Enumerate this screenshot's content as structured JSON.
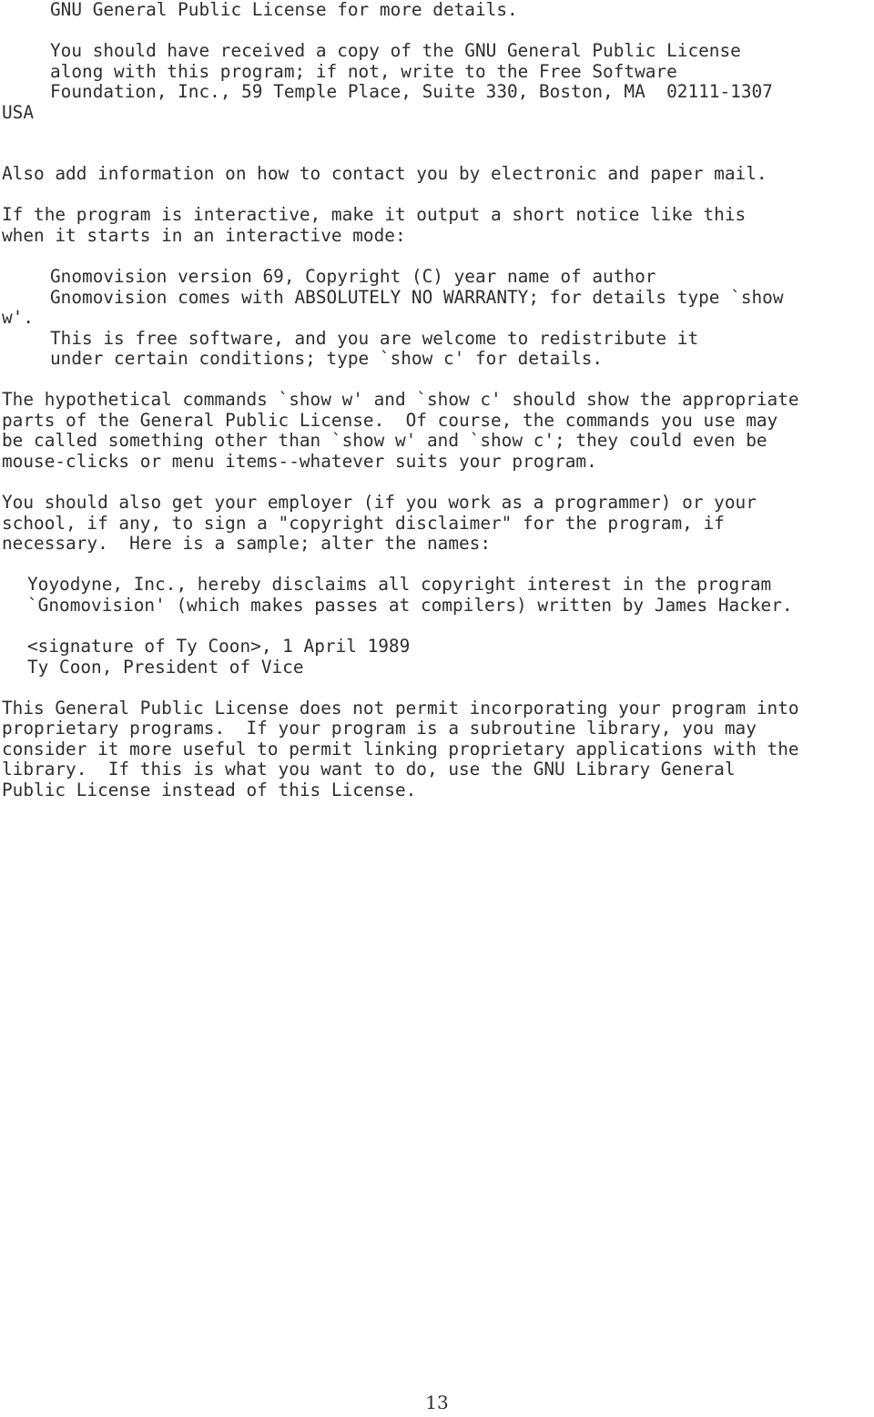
{
  "document": {
    "page_number": "13",
    "text_color": "#2e2e2e",
    "background_color": "#ffffff",
    "lines": [
      {
        "indent": "q",
        "text": "GNU General Public License for more details."
      },
      {
        "indent": "blank",
        "text": ""
      },
      {
        "indent": "q",
        "text": "You should have received a copy of the GNU General Public License"
      },
      {
        "indent": "q",
        "text": "along with this program; if not, write to the Free Software"
      },
      {
        "indent": "q",
        "text": "Foundation, Inc., 59 Temple Place, Suite 330, Boston, MA  02111-1307"
      },
      {
        "indent": "0",
        "text": "USA"
      },
      {
        "indent": "blank",
        "text": ""
      },
      {
        "indent": "blank",
        "text": ""
      },
      {
        "indent": "0",
        "text": "Also add information on how to contact you by electronic and paper mail."
      },
      {
        "indent": "blank",
        "text": ""
      },
      {
        "indent": "0",
        "text": "If the program is interactive, make it output a short notice like this"
      },
      {
        "indent": "0",
        "text": "when it starts in an interactive mode:"
      },
      {
        "indent": "blank",
        "text": ""
      },
      {
        "indent": "q",
        "text": "Gnomovision version 69, Copyright (C) year name of author"
      },
      {
        "indent": "q",
        "text": "Gnomovision comes with ABSOLUTELY NO WARRANTY; for details type `show"
      },
      {
        "indent": "0",
        "text": "w'."
      },
      {
        "indent": "q",
        "text": "This is free software, and you are welcome to redistribute it"
      },
      {
        "indent": "q",
        "text": "under certain conditions; type `show c' for details."
      },
      {
        "indent": "blank",
        "text": ""
      },
      {
        "indent": "0",
        "text": "The hypothetical commands `show w' and `show c' should show the appropriate"
      },
      {
        "indent": "0",
        "text": "parts of the General Public License.  Of course, the commands you use may"
      },
      {
        "indent": "0",
        "text": "be called something other than `show w' and `show c'; they could even be"
      },
      {
        "indent": "0",
        "text": "mouse-clicks or menu items--whatever suits your program."
      },
      {
        "indent": "blank",
        "text": ""
      },
      {
        "indent": "0",
        "text": "You should also get your employer (if you work as a programmer) or your"
      },
      {
        "indent": "0",
        "text": "school, if any, to sign a \"copyright disclaimer\" for the program, if"
      },
      {
        "indent": "0",
        "text": "necessary.  Here is a sample; alter the names:"
      },
      {
        "indent": "blank",
        "text": ""
      },
      {
        "indent": "sig",
        "text": "Yoyodyne, Inc., hereby disclaims all copyright interest in the program"
      },
      {
        "indent": "sig",
        "text": "`Gnomovision' (which makes passes at compilers) written by James Hacker."
      },
      {
        "indent": "blank",
        "text": ""
      },
      {
        "indent": "sig",
        "text": "<signature of Ty Coon>, 1 April 1989"
      },
      {
        "indent": "sig",
        "text": "Ty Coon, President of Vice"
      },
      {
        "indent": "blank",
        "text": ""
      },
      {
        "indent": "0",
        "text": "This General Public License does not permit incorporating your program into"
      },
      {
        "indent": "0",
        "text": "proprietary programs.  If your program is a subroutine library, you may"
      },
      {
        "indent": "0",
        "text": "consider it more useful to permit linking proprietary applications with the"
      },
      {
        "indent": "0",
        "text": "library.  If this is what you want to do, use the GNU Library General"
      },
      {
        "indent": "0",
        "text": "Public License instead of this License."
      }
    ]
  }
}
